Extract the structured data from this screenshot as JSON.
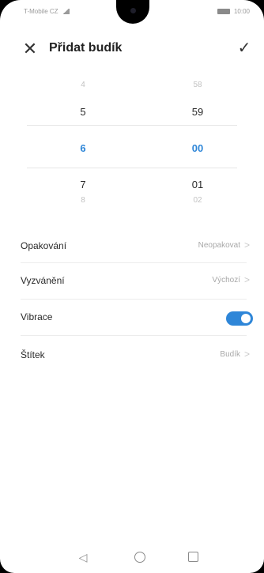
{
  "status_bar": {
    "carrier": "T-Mobile CZ",
    "time": "10:00"
  },
  "header": {
    "close_icon": "close-icon",
    "title": "Přidat budík",
    "confirm_icon": "check-icon"
  },
  "time_picker": {
    "hours": [
      "4",
      "5",
      "6",
      "7",
      "8"
    ],
    "minutes": [
      "58",
      "59",
      "00",
      "01",
      "02"
    ],
    "selected_hour": "6",
    "selected_minute": "00",
    "accent": "#2e86d8"
  },
  "settings": {
    "repeat": {
      "label": "Opakování",
      "value": "Neopakovat"
    },
    "ringtone": {
      "label": "Vyzvánění",
      "value": "Výchozí"
    },
    "vibration": {
      "label": "Vibrace",
      "enabled": true
    },
    "tag": {
      "label": "Štítek",
      "value": "Budík"
    }
  },
  "navbar": {
    "back_icon": "back-triangle-icon",
    "home_icon": "home-circle-icon",
    "recent_icon": "recent-square-icon"
  }
}
